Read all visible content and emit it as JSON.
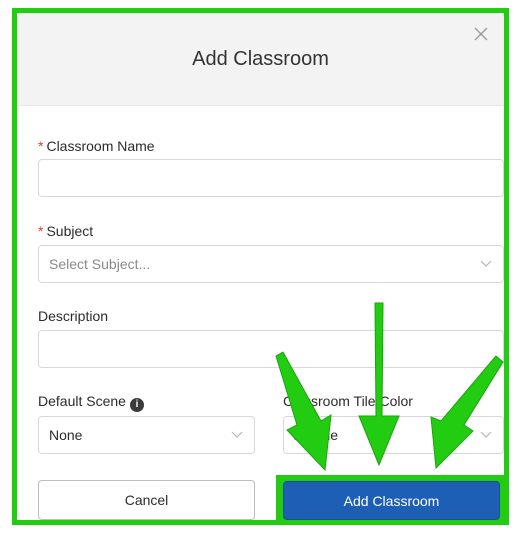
{
  "modal": {
    "title": "Add Classroom",
    "close_glyph": "×"
  },
  "form": {
    "classroom_name": {
      "label": "Classroom Name",
      "required_mark": "*",
      "value": ""
    },
    "subject": {
      "label": "Subject",
      "required_mark": "*",
      "placeholder": "Select Subject..."
    },
    "description": {
      "label": "Description",
      "value": ""
    },
    "default_scene": {
      "label": "Default Scene",
      "info_glyph": "i",
      "value": "None"
    },
    "tile_color": {
      "label": "Classroom Tile Color",
      "value": "Blue",
      "swatch_color": "#2f6fd1"
    }
  },
  "buttons": {
    "cancel": "Cancel",
    "submit": "Add Classroom"
  },
  "annotation": {
    "arrow_color": "#22cc11",
    "arrow_count": 3
  }
}
